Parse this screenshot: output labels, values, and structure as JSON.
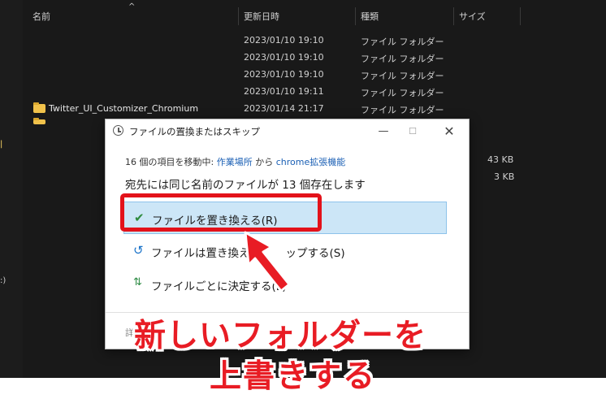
{
  "explorer": {
    "columns": {
      "name": "名前",
      "modified": "更新日時",
      "type": "種類",
      "size": "サイズ"
    },
    "rows": [
      {
        "name": "",
        "modified": "2023/01/10 19:10",
        "type": "ファイル フォルダー"
      },
      {
        "name": "",
        "modified": "2023/01/10 19:10",
        "type": "ファイル フォルダー"
      },
      {
        "name": "",
        "modified": "2023/01/10 19:10",
        "type": "ファイル フォルダー"
      },
      {
        "name": "",
        "modified": "2023/01/10 19:11",
        "type": "ファイル フォルダー"
      },
      {
        "name": "Twitter_UI_Customizer_Chromium",
        "modified": "2023/01/14 21:17",
        "type": "ファイル フォルダー"
      }
    ],
    "sizes": [
      "43 KB",
      "3 KB"
    ]
  },
  "dialog": {
    "title": "ファイルの置換またはスキップ",
    "move_prefix": "16 個の項目を移動中: ",
    "source": "作業場所",
    "from_word": " から ",
    "destination": "chrome拡張機能",
    "conflict_message": "宛先には同じ名前のファイルが 13 個存在します",
    "options": [
      {
        "label": "ファイルを置き換える(R)",
        "icon": "check-icon"
      },
      {
        "label": "ファイルは置き換え",
        "label_tail": "ップする(S)",
        "icon": "skip-arrow-icon"
      },
      {
        "label": "ファイルごとに決定する(L)",
        "icon": "decide-icon"
      }
    ],
    "details": "詳細"
  },
  "annotation": {
    "line1": "新しいフォルダーを",
    "line2": "上書きする",
    "color": "#e81c24"
  }
}
